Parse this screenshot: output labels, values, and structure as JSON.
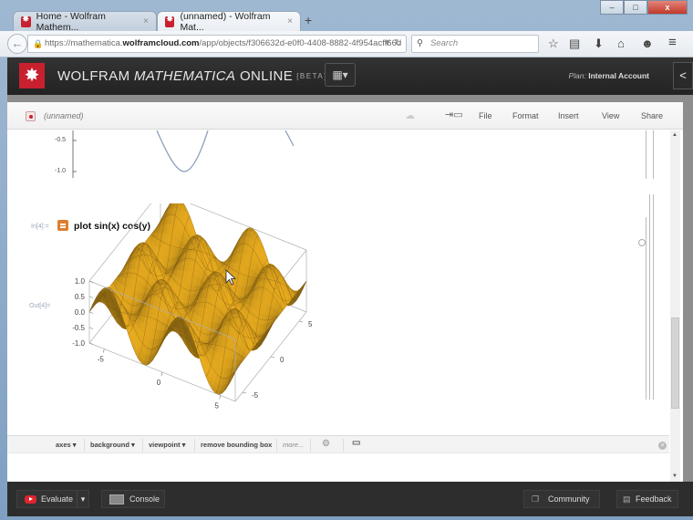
{
  "browser": {
    "tabs": [
      {
        "title": "Home - Wolfram Mathem...",
        "close": "×",
        "active": false
      },
      {
        "title": "(unnamed) - Wolfram Mat...",
        "close": "×",
        "active": true
      }
    ],
    "new_tab": "+",
    "window_buttons": {
      "minimize": "–",
      "maximize": "□",
      "close": "x"
    },
    "url": {
      "prefix": "https://mathematica.",
      "domain": "wolframcloud.com",
      "path": "/app/objects/f306632d-e0f0-4408-8882-4f954acff66d"
    },
    "search_placeholder": "Search",
    "toolbar_icons": [
      "star-icon",
      "reading-list-icon",
      "download-icon",
      "home-icon",
      "chat-icon",
      "menu-icon"
    ]
  },
  "app": {
    "title_parts": {
      "a": "WOLFRAM ",
      "b": "MATHEMATICA",
      "c": " ONLINE",
      "beta": "[BETA]"
    },
    "plan_label": "Plan:",
    "plan_value": "Internal Account",
    "collapse": "<"
  },
  "notebook": {
    "name": "(unnamed)",
    "menus": [
      "File",
      "Format",
      "Insert",
      "View",
      "Share"
    ],
    "previous_plot_ticks": [
      "-0.5",
      "-1.0"
    ],
    "cell": {
      "in_label": "In[4]:=",
      "input": "plot sin(x) cos(y)",
      "out_label": "Out[4]="
    },
    "suggestions": [
      "axes",
      "background",
      "viewpoint",
      "remove bounding box",
      "more..."
    ]
  },
  "chart_data": {
    "type": "surface3d",
    "title": "",
    "function": "sin(x) cos(y)",
    "x_range": [
      -6.28,
      6.28
    ],
    "y_range": [
      -6.28,
      6.28
    ],
    "z_range": [
      -1,
      1
    ],
    "z_ticks": [
      "1.0",
      "0.5",
      "0.0",
      "-0.5",
      "-1.0"
    ],
    "x_ticks": [
      "-5",
      "0",
      "5"
    ],
    "y_ticks": [
      "-5",
      "0",
      "5"
    ],
    "colors": {
      "surface": "#f2b31f",
      "mesh": "#6b4a10",
      "box": "#b0b0b0"
    }
  },
  "footer": {
    "evaluate": "Evaluate",
    "console": "Console",
    "community": "Community",
    "feedback": "Feedback"
  }
}
